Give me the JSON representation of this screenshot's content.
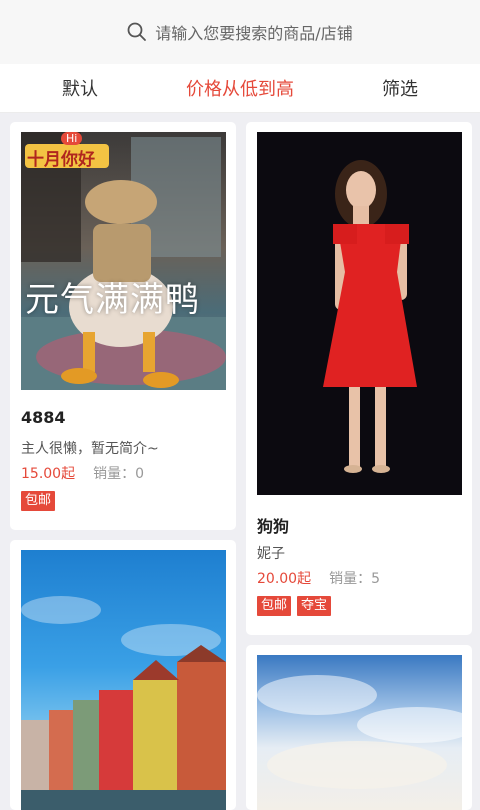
{
  "search": {
    "placeholder": "请输入您要搜索的商品/店铺"
  },
  "sort_tabs": [
    {
      "label": "默认"
    },
    {
      "label": "价格从低到高"
    },
    {
      "label": "筛选"
    }
  ],
  "colors": {
    "accent": "#e5493a",
    "background": "#efeff3"
  },
  "products": [
    {
      "image_text_top": "十月你好",
      "image_badge": "Hi",
      "image_caption": "元气满满鸭",
      "title": "4884",
      "desc": "主人很懒，暂无简介~",
      "price": "15.00起",
      "sales": "销量：0",
      "badges": [
        "包邮"
      ]
    },
    {
      "title": "狗狗",
      "desc": "妮子",
      "price": "20.00起",
      "sales": "销量：5",
      "badges": [
        "包邮",
        "夺宝"
      ]
    }
  ]
}
